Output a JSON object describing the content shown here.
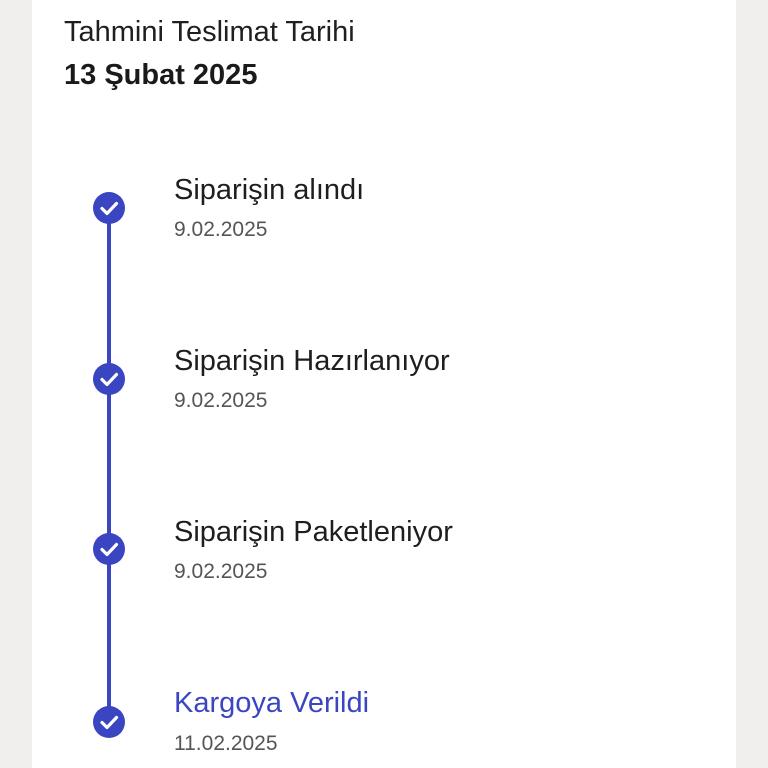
{
  "delivery": {
    "label": "Tahmini Teslimat Tarihi",
    "date": "13 Şubat 2025"
  },
  "accent_color": "#3a45c2",
  "steps": [
    {
      "title": "Siparişin alındı",
      "date": "9.02.2025",
      "status": "completed",
      "icon": "check-icon"
    },
    {
      "title": "Siparişin Hazırlanıyor",
      "date": "9.02.2025",
      "status": "completed",
      "icon": "check-icon"
    },
    {
      "title": "Siparişin Paketleniyor",
      "date": "9.02.2025",
      "status": "completed",
      "icon": "check-icon"
    },
    {
      "title": "Kargoya Verildi",
      "date": "11.02.2025",
      "status": "current",
      "icon": "check-icon"
    }
  ]
}
